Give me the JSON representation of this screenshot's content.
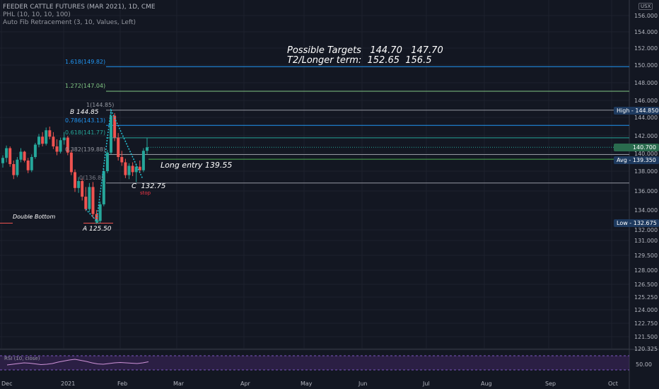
{
  "header": {
    "title": "FEEDER CATTLE FUTURES (MAR 2021), 1D, CME",
    "phl": "PHL (10, 10, 10, 100)",
    "fib": "Auto Fib Retracement (3, 10, Values, Left)"
  },
  "currency_button": "USX",
  "annotations": {
    "targets_line1": "Possible Targets   144.70   147.70",
    "targets_line2": "T2/Longer term:  152.65  156.5",
    "long_entry": "Long entry 139.55",
    "point_b": "B 144.85",
    "point_a": "A 125.50",
    "point_c": "C  132.75",
    "double_bottom": "Double Bottom",
    "stop": "stop"
  },
  "fib_levels": [
    {
      "label": "1.618(149.82)",
      "color": "#2196f3"
    },
    {
      "label": "1.272(147.04)",
      "color": "#81c784"
    },
    {
      "label": "1(144.85)",
      "color": "#9598a1"
    },
    {
      "label": "0.786(143.13)",
      "color": "#2196f3"
    },
    {
      "label": "0.618(141.77)",
      "color": "#26a69a"
    },
    {
      "label": "0.382(139.88)",
      "color": "#9598a1"
    },
    {
      "label": "0(136.8)",
      "color": "#787b86"
    }
  ],
  "price_labels": {
    "high": "High - 144.850",
    "current": "140.700",
    "avg": "Avg - 139.350",
    "low": "Low - 132.675"
  },
  "y_axis_ticks": [
    "156.000",
    "154.000",
    "152.000",
    "150.000",
    "148.000",
    "146.000",
    "144.000",
    "142.000",
    "140.000",
    "138.000",
    "136.000",
    "134.000",
    "132.000",
    "131.000",
    "129.500",
    "128.000",
    "126.500",
    "125.250",
    "124.000",
    "122.750",
    "121.500",
    "120.325"
  ],
  "x_axis_labels": [
    "Dec",
    "2021",
    "Feb",
    "Mar",
    "Apr",
    "May",
    "Jun",
    "Jul",
    "Aug",
    "Sep",
    "Oct"
  ],
  "rsi": {
    "label": "RSI (10, close)",
    "level_label": "50.00"
  },
  "colors": {
    "up": "#26a69a",
    "down": "#ef5350",
    "background": "#131722",
    "rsi_fill": "#4a2a6e",
    "rsi_line": "#ce93d8"
  },
  "chart_data": {
    "type": "candlestick",
    "x_unit": "trading day index",
    "ohlc": [
      [
        138.9,
        139.8,
        138.4,
        139.5
      ],
      [
        139.5,
        140.9,
        139.0,
        140.6
      ],
      [
        140.6,
        140.8,
        138.5,
        138.8
      ],
      [
        138.8,
        139.2,
        137.2,
        137.6
      ],
      [
        137.6,
        139.6,
        137.4,
        139.3
      ],
      [
        139.3,
        140.6,
        139.0,
        140.2
      ],
      [
        140.2,
        140.3,
        139.0,
        139.2
      ],
      [
        139.2,
        139.5,
        137.8,
        138.1
      ],
      [
        138.1,
        139.9,
        137.9,
        139.6
      ],
      [
        139.6,
        141.2,
        139.4,
        141.0
      ],
      [
        141.0,
        142.2,
        140.7,
        141.9
      ],
      [
        141.9,
        142.4,
        140.8,
        141.1
      ],
      [
        141.1,
        142.9,
        140.9,
        142.6
      ],
      [
        142.6,
        143.0,
        141.6,
        141.9
      ],
      [
        141.9,
        142.4,
        140.5,
        140.8
      ],
      [
        140.8,
        141.6,
        139.8,
        140.2
      ],
      [
        140.2,
        141.8,
        140.0,
        141.5
      ],
      [
        141.5,
        142.4,
        141.0,
        141.8
      ],
      [
        141.8,
        142.0,
        139.8,
        140.1
      ],
      [
        140.1,
        140.4,
        137.6,
        137.9
      ],
      [
        137.9,
        138.2,
        135.9,
        136.3
      ],
      [
        136.3,
        137.4,
        135.8,
        137.0
      ],
      [
        137.0,
        137.3,
        135.0,
        135.4
      ],
      [
        135.4,
        136.4,
        133.9,
        134.1
      ],
      [
        134.1,
        136.8,
        133.8,
        136.4
      ],
      [
        136.4,
        136.9,
        133.2,
        133.6
      ],
      [
        133.6,
        134.0,
        132.6,
        132.9
      ],
      [
        132.9,
        134.9,
        132.7,
        134.6
      ],
      [
        134.6,
        138.3,
        134.4,
        138.0
      ],
      [
        138.0,
        140.4,
        137.8,
        140.1
      ],
      [
        140.1,
        144.85,
        139.9,
        144.2
      ],
      [
        144.2,
        144.5,
        141.4,
        141.8
      ],
      [
        141.8,
        142.3,
        139.2,
        139.6
      ],
      [
        139.6,
        140.3,
        138.6,
        139.0
      ],
      [
        139.0,
        139.4,
        137.3,
        137.6
      ],
      [
        137.6,
        138.9,
        137.2,
        138.6
      ],
      [
        138.6,
        139.0,
        137.5,
        137.9
      ],
      [
        137.9,
        138.8,
        136.9,
        138.5
      ],
      [
        138.5,
        139.2,
        137.8,
        138.1
      ],
      [
        138.1,
        140.6,
        137.9,
        140.3
      ],
      [
        140.3,
        141.8,
        139.9,
        140.7
      ]
    ],
    "horizontal_levels": [
      {
        "name": "1.618",
        "value": 149.82
      },
      {
        "name": "1.272",
        "value": 147.04
      },
      {
        "name": "1",
        "value": 144.85
      },
      {
        "name": "0.786",
        "value": 143.13
      },
      {
        "name": "0.618",
        "value": 141.77
      },
      {
        "name": "0.382",
        "value": 139.88
      },
      {
        "name": "0",
        "value": 136.8
      },
      {
        "name": "avg",
        "value": 139.35
      },
      {
        "name": "low",
        "value": 132.675
      }
    ],
    "rsi_values": [
      44,
      46,
      48,
      50,
      49,
      47,
      45,
      46,
      48,
      52,
      55,
      58,
      60,
      57,
      54,
      50,
      47,
      46,
      48,
      50,
      51,
      50,
      49,
      48,
      50,
      53
    ]
  }
}
